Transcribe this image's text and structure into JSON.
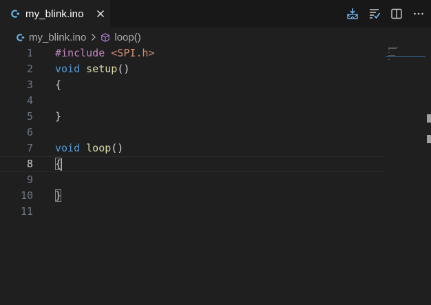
{
  "tab": {
    "title": "my_blink.ino",
    "file_icon": "cpp-file-icon",
    "close_icon": "close-icon"
  },
  "toolbar": {
    "actions": [
      {
        "name": "upload-icon"
      },
      {
        "name": "verify-icon"
      },
      {
        "name": "split-editor-icon"
      },
      {
        "name": "more-actions-icon"
      }
    ]
  },
  "breadcrumb": {
    "file": "my_blink.ino",
    "symbol": "loop()"
  },
  "editor": {
    "current_line": 8,
    "lines": [
      {
        "n": "1",
        "tokens": [
          {
            "t": "#include ",
            "c": "pp"
          },
          {
            "t": "<SPI.h>",
            "c": "inc"
          }
        ]
      },
      {
        "n": "2",
        "tokens": [
          {
            "t": "void",
            "c": "kw"
          },
          {
            "t": " ",
            "c": ""
          },
          {
            "t": "setup",
            "c": "fn"
          },
          {
            "t": "()",
            "c": "br"
          }
        ]
      },
      {
        "n": "3",
        "tokens": [
          {
            "t": "{",
            "c": "br"
          }
        ]
      },
      {
        "n": "4",
        "tokens": []
      },
      {
        "n": "5",
        "tokens": [
          {
            "t": "}",
            "c": "br"
          }
        ]
      },
      {
        "n": "6",
        "tokens": []
      },
      {
        "n": "7",
        "tokens": [
          {
            "t": "void",
            "c": "kw"
          },
          {
            "t": " ",
            "c": ""
          },
          {
            "t": "loop",
            "c": "fn"
          },
          {
            "t": "()",
            "c": "br"
          }
        ]
      },
      {
        "n": "8",
        "tokens": [
          {
            "t": "{",
            "c": "br",
            "match": true
          }
        ]
      },
      {
        "n": "9",
        "tokens": []
      },
      {
        "n": "10",
        "tokens": [
          {
            "t": "}",
            "c": "br",
            "match": true
          }
        ]
      },
      {
        "n": "11",
        "tokens": []
      }
    ]
  },
  "colors": {
    "background": "#1f1f1f",
    "tabbar": "#181818",
    "keyword": "#569cd6",
    "preprocessor": "#c586c0",
    "string": "#ce9178",
    "function": "#dcdcaa",
    "line_number": "#6e7681"
  }
}
